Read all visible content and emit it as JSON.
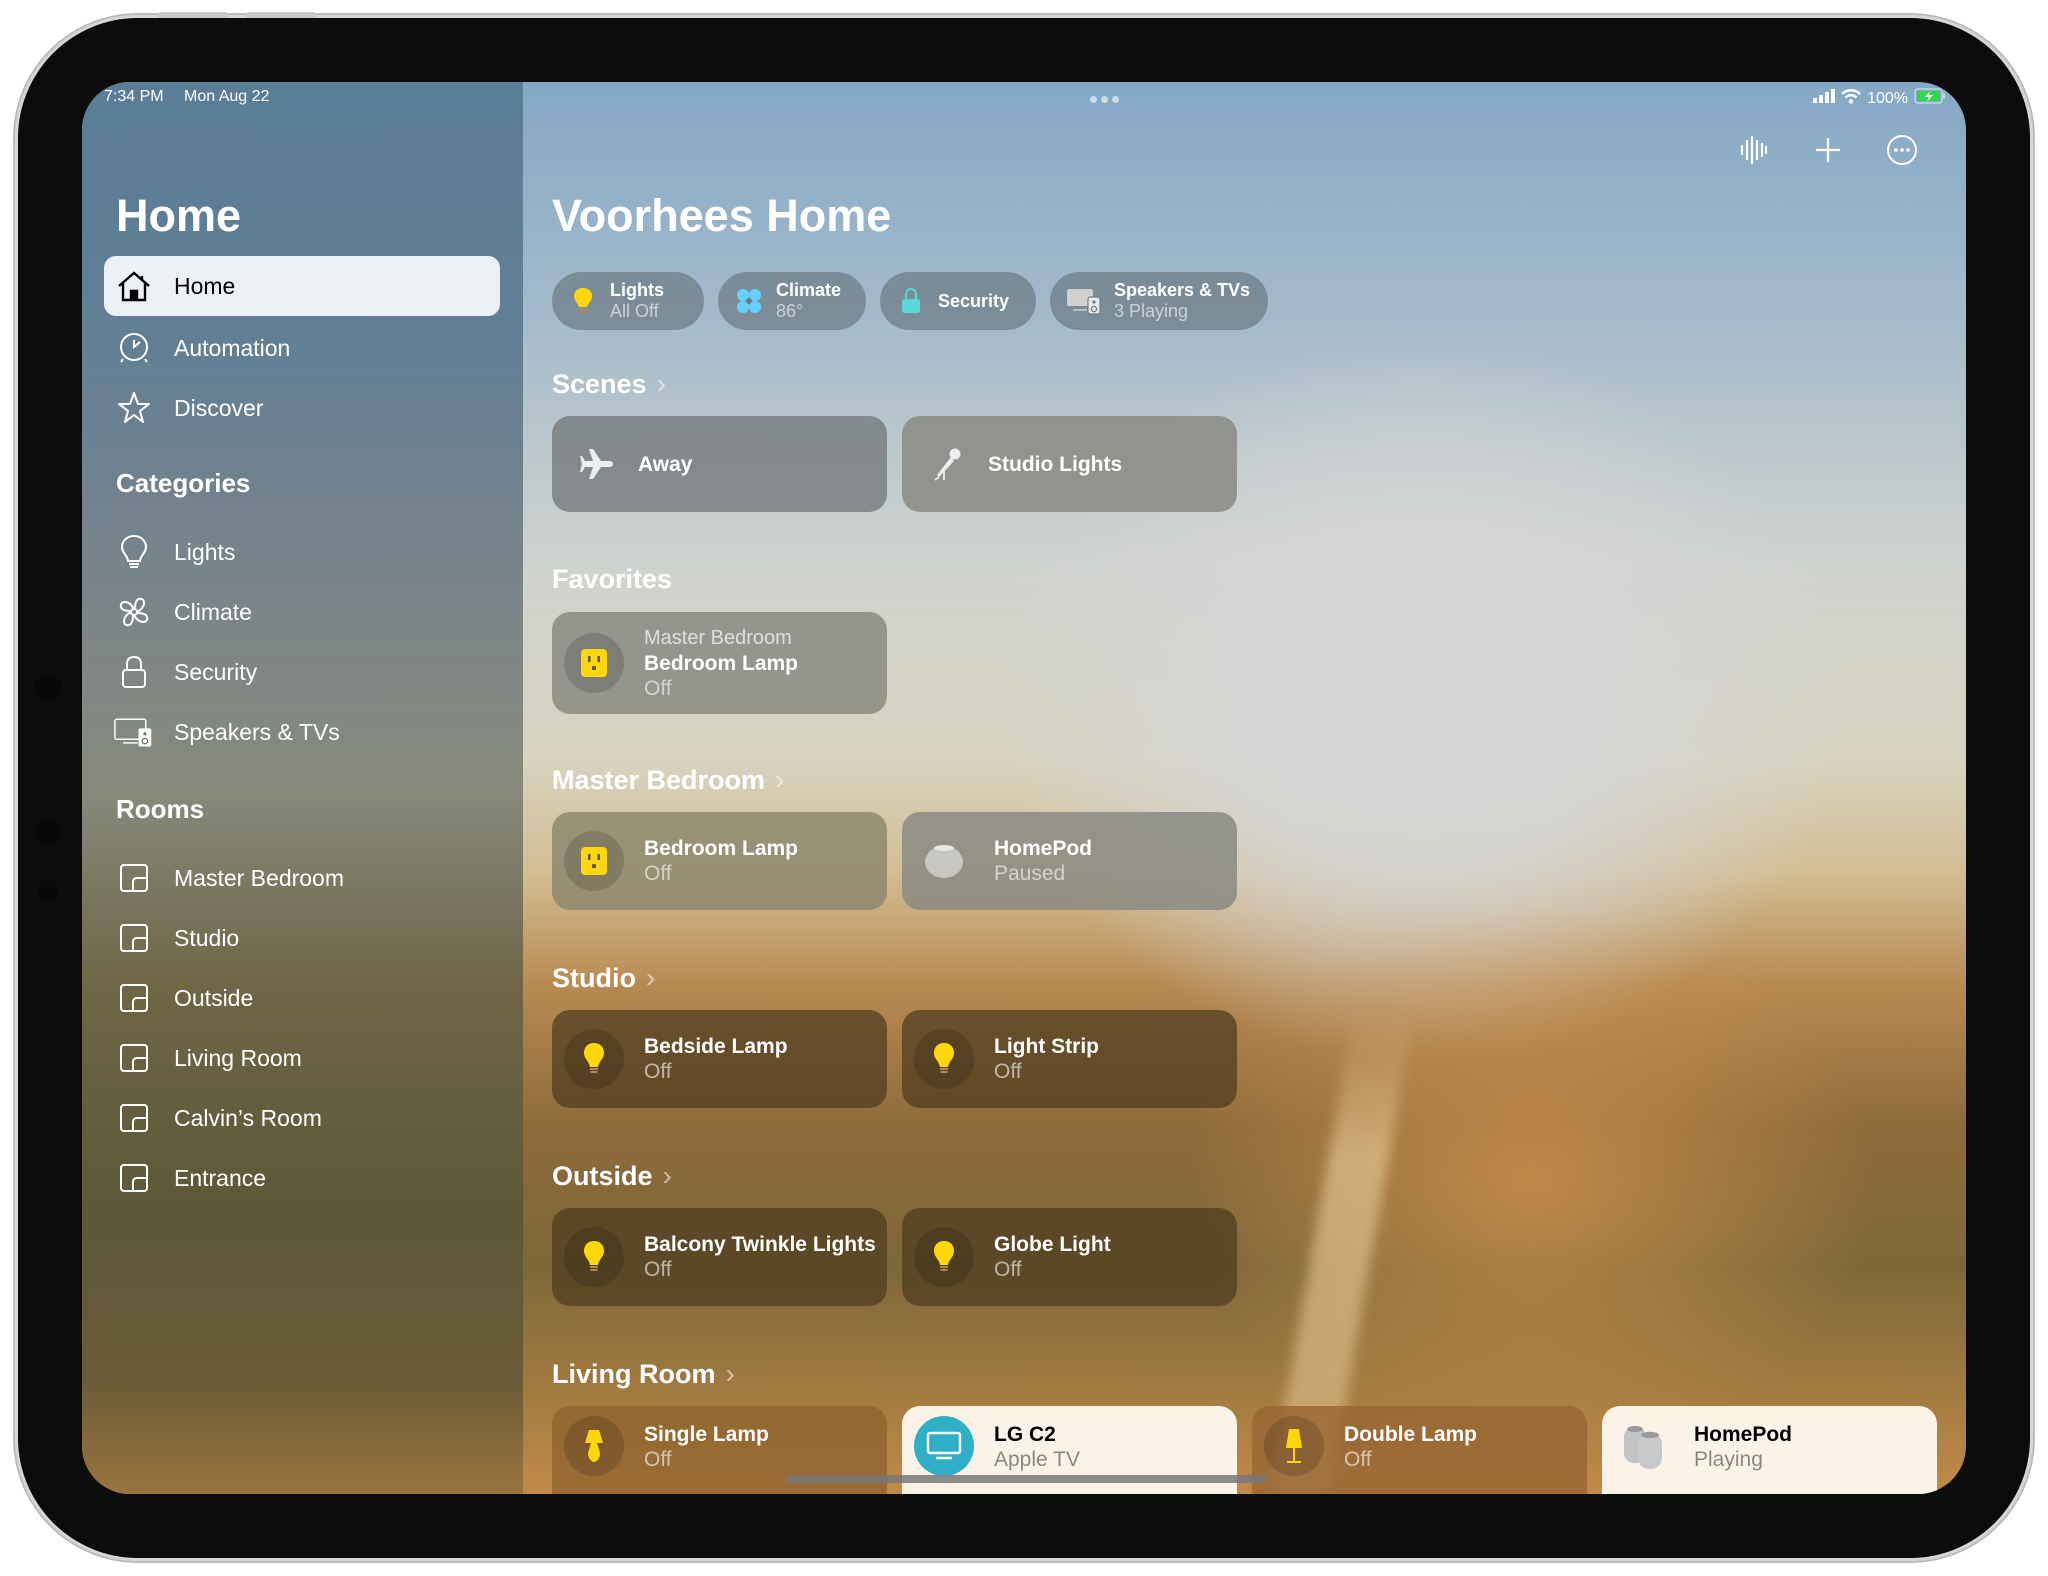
{
  "status_bar": {
    "time": "7:34 PM",
    "date": "Mon Aug 22",
    "battery": "100%",
    "battery_color": "#32d74b"
  },
  "sidebar": {
    "title": "Home",
    "nav": [
      {
        "label": "Home",
        "icon": "house-icon",
        "active": true
      },
      {
        "label": "Automation",
        "icon": "clock-icon"
      },
      {
        "label": "Discover",
        "icon": "star-icon"
      }
    ],
    "categories_heading": "Categories",
    "categories": [
      {
        "label": "Lights",
        "icon": "lightbulb-icon"
      },
      {
        "label": "Climate",
        "icon": "fan-icon"
      },
      {
        "label": "Security",
        "icon": "lock-icon"
      },
      {
        "label": "Speakers & TVs",
        "icon": "tv-speaker-icon"
      }
    ],
    "rooms_heading": "Rooms",
    "rooms": [
      {
        "label": "Master Bedroom",
        "icon": "room-icon"
      },
      {
        "label": "Studio",
        "icon": "room-icon"
      },
      {
        "label": "Outside",
        "icon": "room-icon"
      },
      {
        "label": "Living Room",
        "icon": "room-icon"
      },
      {
        "label": "Calvin’s Room",
        "icon": "room-icon"
      },
      {
        "label": "Entrance",
        "icon": "room-icon"
      }
    ]
  },
  "main": {
    "title": "Voorhees Home",
    "toolbar": [
      "siri-waveform-icon",
      "plus-icon",
      "more-icon"
    ],
    "status_pills": [
      {
        "title": "Lights",
        "subtitle": "All Off",
        "icon": "lightbulb-icon",
        "color": "#ffd60a"
      },
      {
        "title": "Climate",
        "subtitle": "86°",
        "icon": "fan-icon",
        "color": "#64d2ff"
      },
      {
        "title": "Security",
        "subtitle": "",
        "icon": "lock-icon",
        "color": "#5ad8d8"
      },
      {
        "title": "Speakers & TVs",
        "subtitle": "3 Playing",
        "icon": "tv-speaker-icon",
        "color": "#d0d0d0"
      }
    ],
    "scenes": {
      "heading": "Scenes",
      "items": [
        {
          "label": "Away",
          "icon": "airplane-icon"
        },
        {
          "label": "Studio Lights",
          "icon": "microphone-icon"
        }
      ]
    },
    "favorites": {
      "heading": "Favorites",
      "items": [
        {
          "room": "Master Bedroom",
          "name": "Bedroom Lamp",
          "state": "Off",
          "icon": "outlet-icon"
        }
      ]
    },
    "rooms": [
      {
        "heading": "Master Bedroom",
        "items": [
          {
            "name": "Bedroom Lamp",
            "state": "Off",
            "icon": "outlet-icon"
          },
          {
            "name": "HomePod",
            "state": "Paused",
            "icon": "homepod-mini-icon"
          }
        ]
      },
      {
        "heading": "Studio",
        "items": [
          {
            "name": "Bedside Lamp",
            "state": "Off",
            "icon": "lightbulb-icon"
          },
          {
            "name": "Light Strip",
            "state": "Off",
            "icon": "lightbulb-icon"
          }
        ]
      },
      {
        "heading": "Outside",
        "items": [
          {
            "name": "Balcony Twinkle Lights",
            "state": "Off",
            "icon": "lightbulb-icon"
          },
          {
            "name": "Globe Light",
            "state": "Off",
            "icon": "lightbulb-icon"
          }
        ]
      },
      {
        "heading": "Living Room",
        "items": [
          {
            "name": "Single Lamp",
            "state": "Off",
            "icon": "table-lamp-icon"
          },
          {
            "name": "LG C2",
            "state": "Apple TV",
            "icon": "tv-icon"
          },
          {
            "name": "Double Lamp",
            "state": "Off",
            "icon": "floor-lamp-icon"
          },
          {
            "name": "HomePod",
            "state": "Playing",
            "icon": "homepod-pair-icon"
          }
        ]
      }
    ]
  }
}
